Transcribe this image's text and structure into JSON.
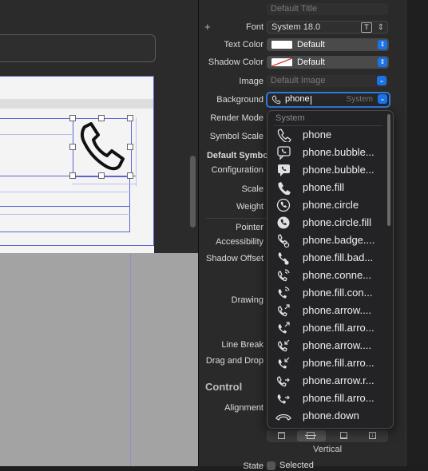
{
  "inspector": {
    "title_placeholder": "Default Title",
    "font_label": "Font",
    "font_value": "System 18.0",
    "text_color_label": "Text Color",
    "text_color_value": "Default",
    "shadow_color_label": "Shadow Color",
    "shadow_color_value": "Default",
    "image_label": "Image",
    "image_placeholder": "Default Image",
    "background_label": "Background",
    "background_value": "phone",
    "background_hint": "System",
    "render_mode_label": "Render Mode",
    "symbol_scale_label": "Symbol Scale",
    "default_symbol_label": "Default Symbo",
    "configuration_label": "Configuration",
    "scale_label": "Scale",
    "weight_label": "Weight",
    "pointer_label": "Pointer",
    "accessibility_label": "Accessibility",
    "shadow_offset_label": "Shadow Offset",
    "drawing_label": "Drawing",
    "line_break_label": "Line Break",
    "drag_drop_label": "Drag and Drop",
    "control_heading": "Control",
    "alignment_label": "Alignment",
    "vertical_label": "Vertical",
    "state_label": "State",
    "selected_label": "Selected",
    "accent_color": "#1a73e8"
  },
  "menu": {
    "section": "System",
    "items": [
      {
        "label": "phone",
        "icon": "phone-icon"
      },
      {
        "label": "phone.bubble...",
        "icon": "phone-bubble-icon"
      },
      {
        "label": "phone.bubble...",
        "icon": "phone-bubble-fill-icon"
      },
      {
        "label": "phone.fill",
        "icon": "phone-fill-icon"
      },
      {
        "label": "phone.circle",
        "icon": "phone-circle-icon"
      },
      {
        "label": "phone.circle.fill",
        "icon": "phone-circle-fill-icon"
      },
      {
        "label": "phone.badge....",
        "icon": "phone-badge-icon"
      },
      {
        "label": "phone.fill.bad...",
        "icon": "phone-fill-badge-icon"
      },
      {
        "label": "phone.conne...",
        "icon": "phone-connection-icon"
      },
      {
        "label": "phone.fill.con...",
        "icon": "phone-fill-connection-icon"
      },
      {
        "label": "phone.arrow....",
        "icon": "phone-arrow-icon"
      },
      {
        "label": "phone.fill.arro...",
        "icon": "phone-fill-arrow-icon"
      },
      {
        "label": "phone.arrow....",
        "icon": "phone-arrow-down-icon"
      },
      {
        "label": "phone.fill.arro...",
        "icon": "phone-fill-arrow-down-icon"
      },
      {
        "label": "phone.arrow.r...",
        "icon": "phone-arrow-right-icon"
      },
      {
        "label": "phone.fill.arro...",
        "icon": "phone-fill-arrow-right-icon"
      },
      {
        "label": "phone.down",
        "icon": "phone-down-icon"
      }
    ]
  }
}
